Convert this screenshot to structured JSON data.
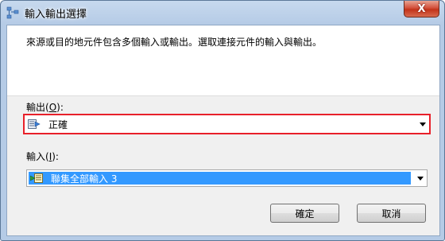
{
  "window": {
    "title": "輸入輸出選擇",
    "close_label": "X"
  },
  "description": "來源或目的地元件包含多個輸入或輸出。選取連接元件的輸入與輸出。",
  "output": {
    "label_prefix": "輸出(",
    "label_key": "O",
    "label_suffix": "):",
    "selected_value": "正確"
  },
  "input": {
    "label_prefix": "輸入(",
    "label_key": "I",
    "label_suffix": "):",
    "selected_value": "聯集全部輸入 3"
  },
  "buttons": {
    "ok_label": "確定",
    "cancel_label": "取消"
  },
  "colors": {
    "highlight_border": "#e8202a",
    "selection": "#3399ff"
  }
}
